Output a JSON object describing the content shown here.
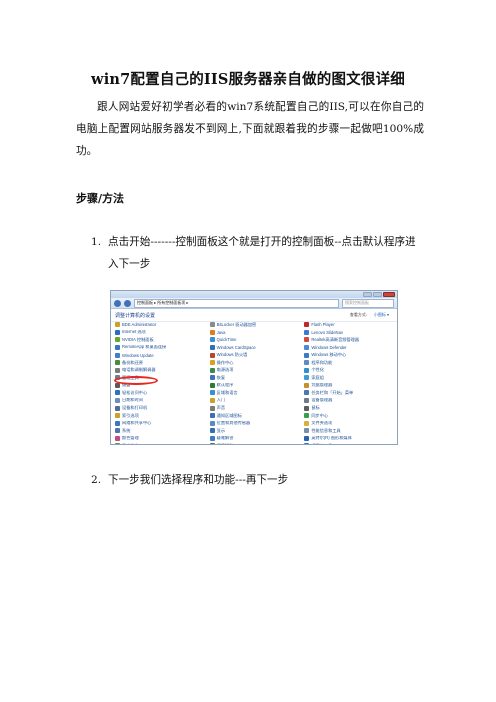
{
  "title": "win7配置自己的IIS服务器亲自做的图文很详细",
  "intro": "跟人网站爱好初学者必看的win7系统配置自己的IIS,可以在你自己的电脑上配置网站服务器发不到网上,下面就跟着我的步骤一起做吧100%成功。",
  "section_heading": "步骤/方法",
  "steps": [
    {
      "num": "1.",
      "text": "点击开始-------控制面板这个就是打开的控制面板--点击默认程序进入下一步"
    },
    {
      "num": "2.",
      "text": "下一步我们选择程序和功能---再下一步"
    }
  ],
  "screenshot": {
    "address": "控制面板 ▸ 所有控制面板项 ▸",
    "search_placeholder": "搜索控制面板",
    "panel_title": "调整计算机的设置",
    "view_by": "查看方式:",
    "view_mode": "小图标 ▾",
    "items": [
      {
        "label": "BDE Administrator",
        "color": "#c9a227"
      },
      {
        "label": "BitLocker 驱动器加密",
        "color": "#8a8a8a"
      },
      {
        "label": "Flash Player",
        "color": "#c0262d"
      },
      {
        "label": "Internet 选项",
        "color": "#2b6cc4"
      },
      {
        "label": "Java",
        "color": "#e07b1f"
      },
      {
        "label": "Lenovo SlideNav",
        "color": "#3b7bd1"
      },
      {
        "label": "NVIDIA 控制面板",
        "color": "#6aa82a"
      },
      {
        "label": "QuickTime",
        "color": "#3a90d6"
      },
      {
        "label": "Realtek高清晰音频管理器",
        "color": "#d14b3a"
      },
      {
        "label": "RemoteApp 和桌面连接",
        "color": "#3a76bf"
      },
      {
        "label": "Windows CardSpace",
        "color": "#2f6fb5"
      },
      {
        "label": "Windows Defender",
        "color": "#4d8bd0"
      },
      {
        "label": "Windows Update",
        "color": "#3f7fcf"
      },
      {
        "label": "Windows 防火墙",
        "color": "#b5452e"
      },
      {
        "label": "Windows 移动中心",
        "color": "#3b7ac7"
      },
      {
        "label": "备份和还原",
        "color": "#4a8a3c"
      },
      {
        "label": "操作中心",
        "color": "#d9a021"
      },
      {
        "label": "程序和功能",
        "color": "#5a8cc9"
      },
      {
        "label": "电话和调制解调器",
        "color": "#7c7c7c"
      },
      {
        "label": "电源选项",
        "color": "#3c8a4a"
      },
      {
        "label": "个性化",
        "color": "#2e8fd1"
      },
      {
        "label": "管理工具",
        "color": "#6b7f98"
      },
      {
        "label": "恢复",
        "color": "#3b74bd"
      },
      {
        "label": "家庭组",
        "color": "#3f9ad6"
      },
      {
        "label": "键盘",
        "color": "#5b5b5b"
      },
      {
        "label": "默认程序",
        "color": "#2d7a37"
      },
      {
        "label": "凭据管理器",
        "color": "#c98e2a"
      },
      {
        "label": "轻松访问中心",
        "color": "#2d72c2"
      },
      {
        "label": "区域和语言",
        "color": "#3a8fcf"
      },
      {
        "label": "任务栏和「开始」菜单",
        "color": "#4d77b3"
      },
      {
        "label": "日期和时间",
        "color": "#6a8fc2"
      },
      {
        "label": "入门",
        "color": "#c9a227"
      },
      {
        "label": "设备管理器",
        "color": "#6c7a8c"
      },
      {
        "label": "设备和打印机",
        "color": "#4f6f9a"
      },
      {
        "label": "声音",
        "color": "#7b7b7b"
      },
      {
        "label": "鼠标",
        "color": "#5d5d5d"
      },
      {
        "label": "索引选项",
        "color": "#c9a227"
      },
      {
        "label": "通知区域图标",
        "color": "#3a6fb8"
      },
      {
        "label": "同步中心",
        "color": "#37a04a"
      },
      {
        "label": "网络和共享中心",
        "color": "#3978c0"
      },
      {
        "label": "位置和其他传感器",
        "color": "#5a8ac0"
      },
      {
        "label": "文件夹选项",
        "color": "#d9b03a"
      },
      {
        "label": "系统",
        "color": "#4b77b0"
      },
      {
        "label": "显示",
        "color": "#2f6fb5"
      },
      {
        "label": "性能信息和工具",
        "color": "#7a8ea8"
      },
      {
        "label": "颜色管理",
        "color": "#c24a8a"
      },
      {
        "label": "疑难解答",
        "color": "#3f7ac4"
      },
      {
        "label": "英特尔(R) 图形和媒体",
        "color": "#2b62b0"
      },
      {
        "label": "用户帐户",
        "color": "#5a9a4a"
      },
      {
        "label": "语音识别",
        "color": "#6a6a6a"
      },
      {
        "label": "桌面小工具",
        "color": "#3b78c7"
      },
      {
        "label": "自动播放",
        "color": "#4a9a3a"
      },
      {
        "label": "字体",
        "color": "#d6b33a"
      }
    ]
  }
}
